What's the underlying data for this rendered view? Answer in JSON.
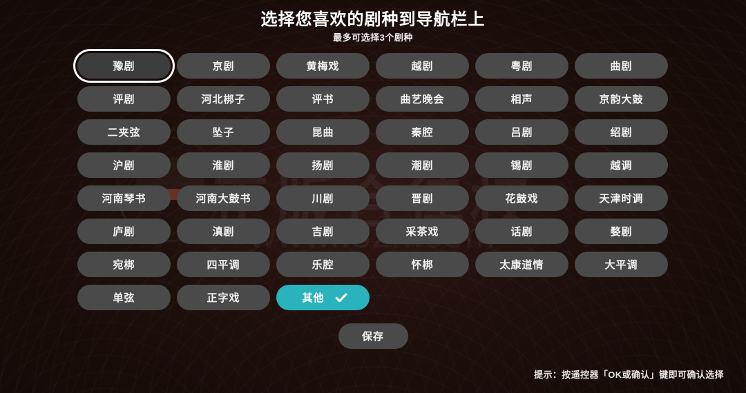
{
  "header": {
    "title": "选择您喜欢的剧种到导航栏上",
    "subtitle": "最多可选择3个剧种"
  },
  "watermark": {
    "text": "正版合律权",
    "url": "www.i3zh.com",
    "logo_icon": "hat-circle-logo-icon"
  },
  "grid": {
    "columns": 6,
    "items": [
      {
        "label": "豫剧",
        "state": "focused"
      },
      {
        "label": "京剧",
        "state": "normal"
      },
      {
        "label": "黄梅戏",
        "state": "normal"
      },
      {
        "label": "越剧",
        "state": "normal"
      },
      {
        "label": "粤剧",
        "state": "normal"
      },
      {
        "label": "曲剧",
        "state": "normal"
      },
      {
        "label": "评剧",
        "state": "normal"
      },
      {
        "label": "河北梆子",
        "state": "normal"
      },
      {
        "label": "评书",
        "state": "normal"
      },
      {
        "label": "曲艺晚会",
        "state": "normal"
      },
      {
        "label": "相声",
        "state": "normal"
      },
      {
        "label": "京韵大鼓",
        "state": "normal"
      },
      {
        "label": "二夹弦",
        "state": "normal"
      },
      {
        "label": "坠子",
        "state": "normal"
      },
      {
        "label": "昆曲",
        "state": "normal"
      },
      {
        "label": "秦腔",
        "state": "normal"
      },
      {
        "label": "吕剧",
        "state": "normal"
      },
      {
        "label": "绍剧",
        "state": "normal"
      },
      {
        "label": "沪剧",
        "state": "normal"
      },
      {
        "label": "淮剧",
        "state": "normal"
      },
      {
        "label": "扬剧",
        "state": "normal"
      },
      {
        "label": "潮剧",
        "state": "normal"
      },
      {
        "label": "锡剧",
        "state": "normal"
      },
      {
        "label": "越调",
        "state": "normal"
      },
      {
        "label": "河南琴书",
        "state": "normal"
      },
      {
        "label": "河南大鼓书",
        "state": "normal"
      },
      {
        "label": "川剧",
        "state": "normal"
      },
      {
        "label": "晋剧",
        "state": "normal"
      },
      {
        "label": "花鼓戏",
        "state": "normal"
      },
      {
        "label": "天津时调",
        "state": "normal"
      },
      {
        "label": "庐剧",
        "state": "normal"
      },
      {
        "label": "滇剧",
        "state": "normal"
      },
      {
        "label": "吉剧",
        "state": "normal"
      },
      {
        "label": "采茶戏",
        "state": "normal"
      },
      {
        "label": "话剧",
        "state": "normal"
      },
      {
        "label": "婺剧",
        "state": "normal"
      },
      {
        "label": "宛梆",
        "state": "normal"
      },
      {
        "label": "四平调",
        "state": "normal"
      },
      {
        "label": "乐腔",
        "state": "normal"
      },
      {
        "label": "怀梆",
        "state": "normal"
      },
      {
        "label": "太康道情",
        "state": "normal"
      },
      {
        "label": "大平调",
        "state": "normal"
      },
      {
        "label": "单弦",
        "state": "normal"
      },
      {
        "label": "正字戏",
        "state": "normal"
      },
      {
        "label": "其他",
        "state": "selected",
        "check_icon": "check-icon"
      }
    ]
  },
  "actions": {
    "save_label": "保存"
  },
  "footer": {
    "hint": "提示：按遥控器「OK或确认」键即可确认选择"
  },
  "colors": {
    "background": "#1a0d0a",
    "chip": "#4a4a4a",
    "chip_selected": "#2bb3bd",
    "focus_ring": "#ffffff",
    "text": "#f2f2f2"
  }
}
